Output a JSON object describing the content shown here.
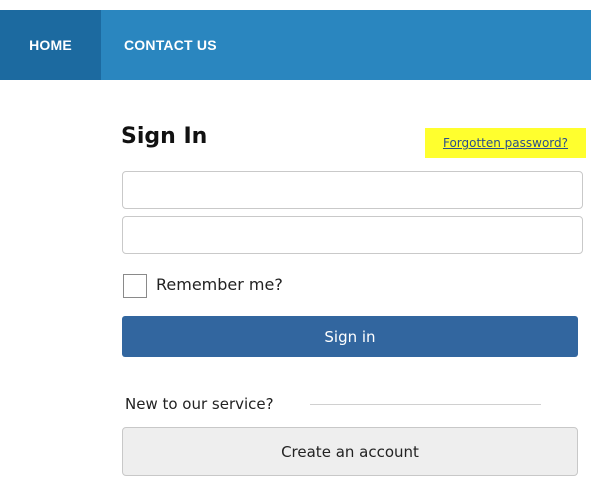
{
  "nav": {
    "home": "HOME",
    "contact": "CONTACT US"
  },
  "signin": {
    "title": "Sign In",
    "forgot_link": "Forgotten password?",
    "username_value": "",
    "password_value": "",
    "remember_label": "Remember me?",
    "remember_checked": false,
    "submit_label": "Sign in",
    "new_prompt": "New to our service?",
    "create_label": "Create an account"
  },
  "colors": {
    "nav_bg": "#2a86bf",
    "nav_active_bg": "#1c6aa0",
    "primary_button": "#32669f",
    "highlight": "#ffff2e"
  }
}
